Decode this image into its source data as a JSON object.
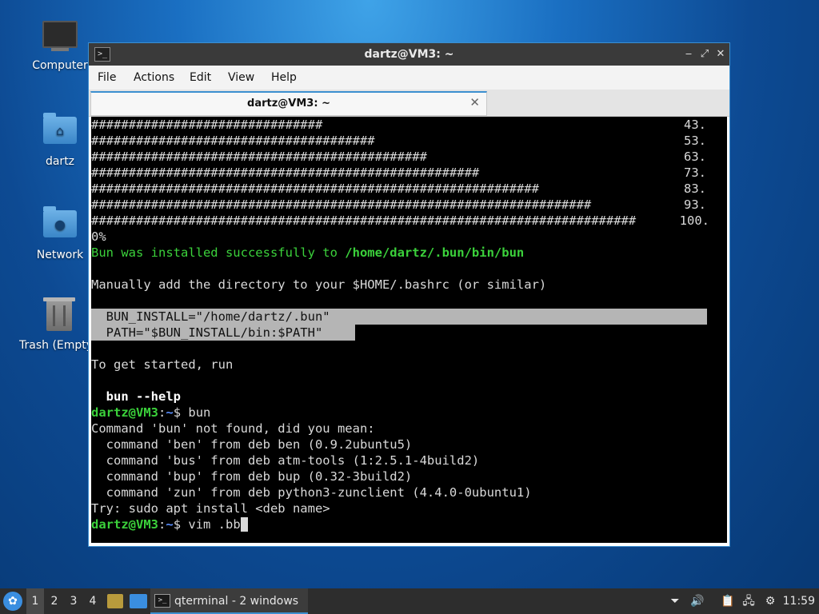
{
  "desktop": {
    "icons": [
      {
        "label": "Computer",
        "icon": "computer-icon"
      },
      {
        "label": "dartz",
        "icon": "home-folder-icon"
      },
      {
        "label": "Network",
        "icon": "network-folder-icon"
      },
      {
        "label": "Trash (Empty)",
        "icon": "trash-icon"
      }
    ]
  },
  "window": {
    "title": "dartz@VM3: ~",
    "controls": {
      "minimize": "‒",
      "maximize": "⤢",
      "close": "✕"
    },
    "menu": [
      "File",
      "Actions",
      "Edit",
      "View",
      "Help"
    ],
    "tab": {
      "label": "dartz@VM3: ~",
      "close": "✕"
    }
  },
  "terminal": {
    "progress_rows": [
      {
        "bar": "###############################",
        "pct": "43."
      },
      {
        "bar": "######################################",
        "pct": "53."
      },
      {
        "bar": "#############################################",
        "pct": "63."
      },
      {
        "bar": "####################################################",
        "pct": "73."
      },
      {
        "bar": "############################################################",
        "pct": "83."
      },
      {
        "bar": "###################################################################",
        "pct": "93."
      },
      {
        "bar": "#########################################################################",
        "pct": "100."
      }
    ],
    "pct_tail": "0%",
    "install_msg": "Bun was installed successfully to ",
    "install_path": "/home/dartz/.bun/bin/bun",
    "manual_msg": "Manually add the directory to your $HOME/.bashrc (or similar)",
    "env1": "  BUN_INSTALL=\"/home/dartz/.bun\"",
    "env2": "  PATH=\"$BUN_INSTALL/bin:$PATH\"",
    "started_msg": "To get started, run",
    "help_cmd": "  bun --help",
    "prompt_user": "dartz@VM3",
    "prompt_sep": ":",
    "prompt_dir": "~",
    "prompt_end": "$ ",
    "cmd1": "bun",
    "not_found": "Command 'bun' not found, did you mean:",
    "suggestions": [
      "  command 'ben' from deb ben (0.9.2ubuntu5)",
      "  command 'bus' from deb atm-tools (1:2.5.1-4build2)",
      "  command 'bup' from deb bup (0.32-3build2)",
      "  command 'zun' from deb python3-zunclient (4.4.0-0ubuntu1)"
    ],
    "try_msg": "Try: sudo apt install <deb name>",
    "cmd2": "vim .bb"
  },
  "taskbar": {
    "workspaces": [
      "1",
      "2",
      "3",
      "4"
    ],
    "active_workspace": "1",
    "task_label": "qterminal - 2 windows",
    "clock": "11:59"
  }
}
